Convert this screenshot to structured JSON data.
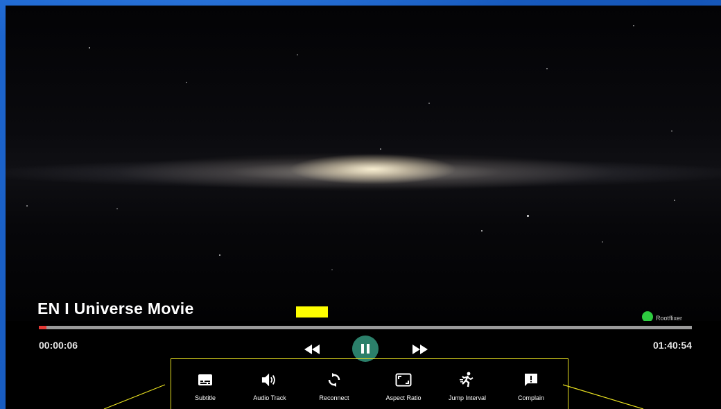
{
  "player": {
    "title": "EN I  Universe Movie",
    "elapsed_time": "00:00:06",
    "total_time": "01:40:54",
    "progress_fraction": 0.0117,
    "state": "playing"
  },
  "live_indicator": {
    "label": "Rootflixer",
    "color": "#2ecc40"
  },
  "menu": {
    "items": [
      {
        "label": "Subtitle",
        "icon": "subtitle-icon"
      },
      {
        "label": "Audio Track",
        "icon": "volume-icon"
      },
      {
        "label": "Reconnect",
        "icon": "reconnect-icon"
      },
      {
        "label": "Aspect Ratio",
        "icon": "aspect-ratio-icon"
      },
      {
        "label": "Jump Interval",
        "icon": "running-icon"
      },
      {
        "label": "Complain",
        "icon": "feedback-icon"
      }
    ]
  },
  "colors": {
    "accent": "#2b7f6a",
    "progress": "#e53935",
    "highlight": "#e8e020",
    "desktop": "#1a5fc4"
  }
}
